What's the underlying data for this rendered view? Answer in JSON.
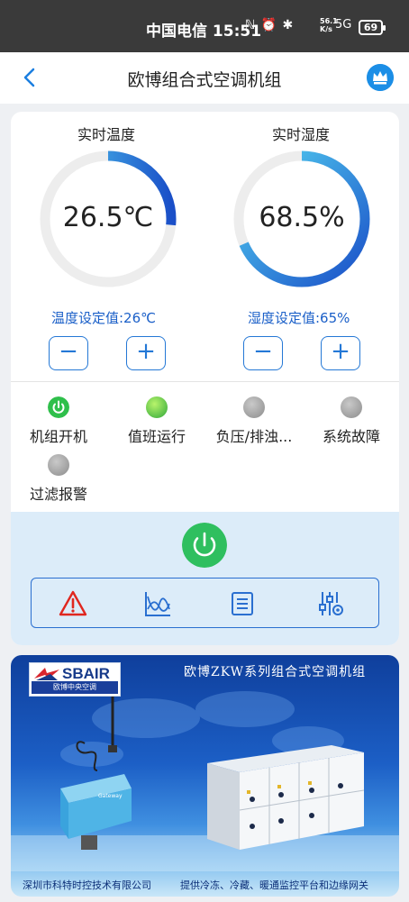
{
  "statusbar": {
    "carrier_time": "中国电信 15:51",
    "icons": "ℕ ⏰ ✱",
    "net_speed_value": "56.1",
    "net_speed_unit": "K/s",
    "signal": "5G",
    "battery": "69"
  },
  "header": {
    "title": "欧博组合式空调机组",
    "back_icon": "chevron-left-icon",
    "vip_icon": "crown-icon"
  },
  "temperature": {
    "label": "实时温度",
    "value": "26.5℃",
    "setpoint": "温度设定值:26℃",
    "gauge_fraction": 0.265,
    "minus": "−",
    "plus": "+"
  },
  "humidity": {
    "label": "实时湿度",
    "value": "68.5%",
    "setpoint": "湿度设定值:65%",
    "gauge_fraction": 0.685,
    "minus": "−",
    "plus": "+"
  },
  "status": [
    {
      "label": "机组开机",
      "state": "power-on"
    },
    {
      "label": "值班运行",
      "state": "green"
    },
    {
      "label": "负压/排浊...",
      "state": "gray"
    },
    {
      "label": "系统故障",
      "state": "gray"
    },
    {
      "label": "过滤报警",
      "state": "gray"
    }
  ],
  "toolbar": [
    "alarm-icon",
    "trend-chart-icon",
    "list-icon",
    "settings-sliders-icon"
  ],
  "banner": {
    "title": "欧博ZKW系列组合式空调机组",
    "logo": "SBAIR",
    "logo_sub": "欧博中央空调",
    "footer_left": "深圳市科特时控技术有限公司",
    "footer_right": "提供冷冻、冷藏、暖通监控平台和边缘网关"
  },
  "colors": {
    "accent": "#1b8ee6",
    "gauge_track": "#ededed",
    "gauge_start": "#1a4fc8",
    "gauge_end": "#55d4f2",
    "power_green": "#2fbf5f"
  }
}
